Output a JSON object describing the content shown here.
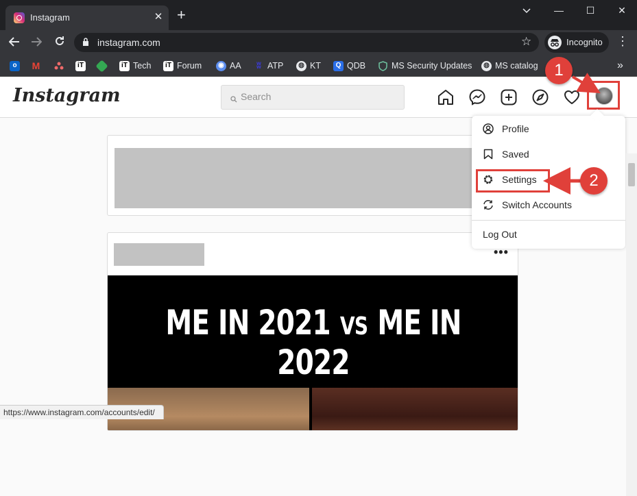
{
  "browser": {
    "tab_title": "Instagram",
    "tab_close": "✕",
    "new_tab": "+",
    "url": "instagram.com",
    "incognito_label": "Incognito",
    "window_controls": {
      "minimize": "—",
      "maximize": "☐",
      "close": "✕"
    },
    "bookmarks": [
      {
        "label": "",
        "icon": "outlook-icon",
        "color": "#0a64c8"
      },
      {
        "label": "",
        "icon": "gmail-icon",
        "color": "#ea4335"
      },
      {
        "label": "",
        "icon": "asana-icon",
        "color": "#f06a6a"
      },
      {
        "label": "",
        "icon": "itechtics-icon",
        "color": "#ffffff"
      },
      {
        "label": "",
        "icon": "diamond-icon",
        "color": "#34a853"
      },
      {
        "label": "Tech",
        "icon": "itechtics-icon",
        "color": "#ffffff"
      },
      {
        "label": "Forum",
        "icon": "itechtics-icon",
        "color": "#ffffff"
      },
      {
        "label": "AA",
        "icon": "eye-icon",
        "color": "#5b8def"
      },
      {
        "label": "ATP",
        "icon": "atp-icon",
        "color": "#3b3bd6"
      },
      {
        "label": "KT",
        "icon": "globe-icon",
        "color": "#e8eaed"
      },
      {
        "label": "QDB",
        "icon": "q-icon",
        "color": "#2a6ee8"
      },
      {
        "label": "MS Security Updates",
        "icon": "shield-icon",
        "color": "#6fc3a0"
      },
      {
        "label": "MS catalog",
        "icon": "globe-icon",
        "color": "#e8eaed"
      }
    ],
    "bookmarks_overflow": "»",
    "status_url": "https://www.instagram.com/accounts/edit/"
  },
  "instagram": {
    "logo": "Instagram",
    "search_placeholder": "Search",
    "post_more": "•••",
    "meme_left": "ME IN 2021",
    "meme_vs": "VS",
    "meme_right": "ME IN 2022"
  },
  "dropdown": {
    "items": [
      {
        "label": "Profile",
        "icon": "profile-icon"
      },
      {
        "label": "Saved",
        "icon": "bookmark-icon"
      },
      {
        "label": "Settings",
        "icon": "gear-icon"
      },
      {
        "label": "Switch Accounts",
        "icon": "switch-icon"
      }
    ],
    "logout": "Log Out"
  },
  "annotations": {
    "step1": "1",
    "step2": "2",
    "color": "#e0403a"
  }
}
